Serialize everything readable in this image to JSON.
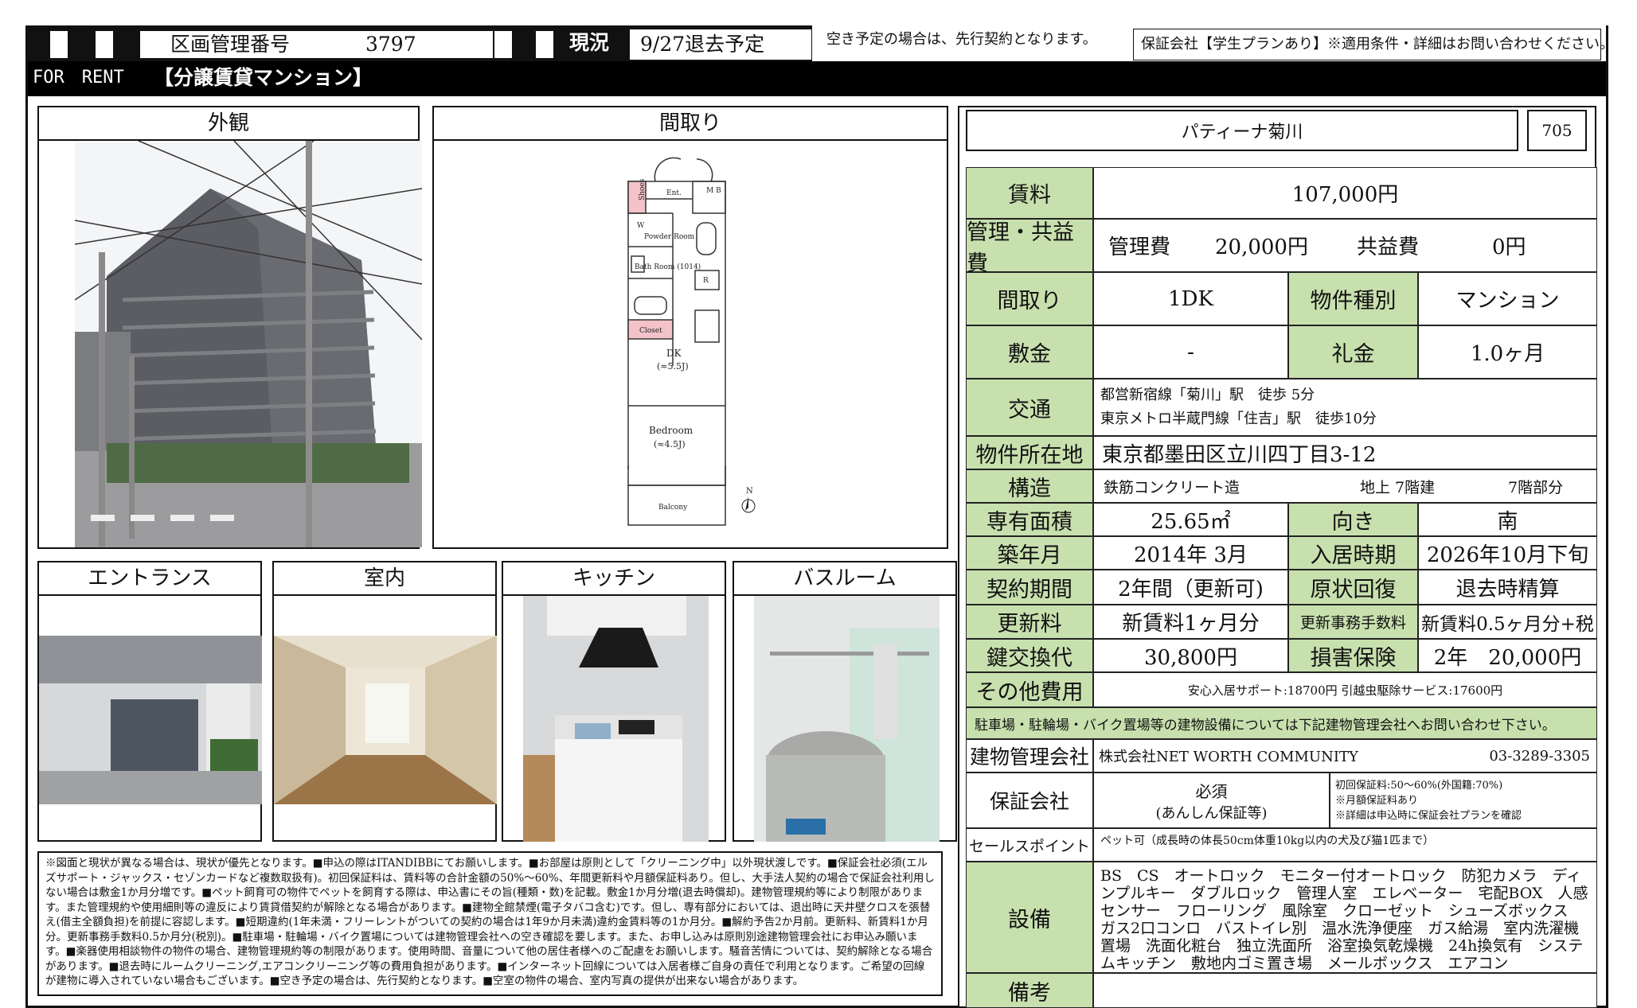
{
  "header": {
    "mgmt_label": "区画管理番号",
    "mgmt_number": "3797",
    "status_label": "現況",
    "status_value": "9/27退去予定",
    "vacancy_note": "空き予定の場合は、先行契約となります。",
    "guarantee_note": "保証会社【学生プランあり】※適用条件・詳細はお問い合わせください。",
    "for_rent": "FOR　RENT",
    "category": "【分譲賃貸マンション】"
  },
  "panels": {
    "exterior": "外観",
    "floorplan": "間取り",
    "entrance": "エントランス",
    "interior": "室内",
    "kitchen": "キッチン",
    "bathroom": "バスルーム"
  },
  "floorplan_labels": {
    "shoes": "Shoes",
    "ent": "Ent.",
    "mb": "M B",
    "w": "W",
    "powder": "Powder Room",
    "bath": "Bath Room (1014)",
    "r": "R",
    "closet": "Closet",
    "dk": "DK",
    "dk_size": "(≈5.5J)",
    "bedroom": "Bedroom",
    "bedroom_size": "(≈4.5J)",
    "balcony": "Balcony",
    "north": "N"
  },
  "property": {
    "name": "パティーナ菊川",
    "room": "705"
  },
  "specs": {
    "rent_label": "賃料",
    "rent": "107,000円",
    "fee_label": "管理・共益費",
    "mgmt_fee_label": "管理費",
    "mgmt_fee": "20,000円",
    "common_fee_label": "共益費",
    "common_fee": "0円",
    "layout_label": "間取り",
    "layout": "1DK",
    "type_label": "物件種別",
    "type": "マンション",
    "deposit_label": "敷金",
    "deposit": "-",
    "key_money_label": "礼金",
    "key_money": "1.0ヶ月",
    "access_label": "交通",
    "access_1": "都営新宿線「菊川」駅　徒歩 5分",
    "access_2": "東京メトロ半蔵門線「住吉」駅　徒歩10分",
    "address_label": "物件所在地",
    "address": "東京都墨田区立川四丁目3-12",
    "structure_label": "構造",
    "structure": "鉄筋コンクリート造",
    "floors": "地上 7階建",
    "floor": "7階部分",
    "area_label": "専有面積",
    "area": "25.65㎡",
    "direction_label": "向き",
    "direction": "南",
    "built_label": "築年月",
    "built": "2014年 3月",
    "movein_label": "入居時期",
    "movein": "2026年10月下旬",
    "term_label": "契約期間",
    "term": "2年間（更新可)",
    "restore_label": "原状回復",
    "restore": "退去時精算",
    "renewal_label": "更新料",
    "renewal": "新賃料1ヶ月分",
    "renewal_fee_label": "更新事務手数料",
    "renewal_fee": "新賃料0.5ヶ月分+税",
    "key_label": "鍵交換代",
    "key": "30,800円",
    "insurance_label": "損害保険",
    "insurance": "2年　20,000円",
    "other_label": "その他費用",
    "other": "安心入居サポート:18700円 引越虫駆除サービス:17600円",
    "parking_note": "駐車場・駐輪場・バイク置場等の建物設備については下記建物管理会社へお問い合わせ下さい。",
    "mgmt_co_label": "建物管理会社",
    "mgmt_co": "株式会社NET WORTH COMMUNITY",
    "mgmt_tel": "03-3289-3305",
    "guarantor_label": "保証会社",
    "guarantor_req": "必須",
    "guarantor_name": "(あんしん保証等)",
    "guarantor_note1": "初回保証料:50～60%(外国籍:70%)",
    "guarantor_note2": "※月額保証料あり",
    "guarantor_note3": "※詳細は申込時に保証会社プランを確認",
    "sales_label": "セールスポイント",
    "sales": "ペット可（成長時の体長50cm体重10kg以内の犬及び猫1匹まで）",
    "equipment_label": "設備",
    "equipment": "BS　CS　オートロック　モニター付オートロック　防犯カメラ　ディンプルキー　ダブルロック　管理人室　エレベーター　宅配BOX　人感センサー　フローリング　風除室　クローゼット　シューズボックス　ガス2口コンロ　バストイレ別　温水洗浄便座　ガス給湯　室内洗濯機置場　洗面化粧台　独立洗面所　浴室換気乾燥機　24h換気有　システムキッチン　敷地内ゴミ置き場　メールボックス　エアコン",
    "remarks_label": "備考"
  },
  "notes": "※図面と現状が異なる場合は、現状が優先となります。■申込の際はITANDIBBにてお願いします。■お部屋は原則として「クリーニング中」以外現状渡しです。■保証会社必須(エルズサポート・ジャックス・セゾンカードなど複数取扱有)。初回保証料は、賃料等の合計金額の50%～60%、年間更新料や月額保証料あり。但し、大手法人契約の場合で保証会社利用しない場合は敷金1か月分増です。■ペット飼育可の物件でペットを飼育する際は、申込書にその旨(種類・数)を記載。敷金1か月分増(退去時償却)。建物管理規約等により制限があります。また管理規約や使用細則等の違反により賃貸借契約が解除となる場合があります。■建物全館禁煙(電子タバコ含む)です。但し、専有部分においては、退出時に天井壁クロスを張替え(借主全額負担)を前提に容認します。■短期違約(1年未満・フリーレントがついての契約の場合は1年9か月未満)違約金賃料等の1か月分。■解約予告2か月前。更新料、新賃料1か月分。更新事務手数料0.5か月分(税別)。■駐車場・駐輪場・バイク置場については建物管理会社への空き確認を要します。また、お申し込みは原則別途建物管理会社にお申込み願います。■楽器使用相談物件の物件の場合、建物管理規約等の制限があります。使用時間、音量について他の居住者様へのご配慮をお願いします。騒音苦情については、契約解除となる場合があります。■退去時にルームクリーニング,エアコンクリーニング等の費用負担があります。■インターネット回線については入居者様ご自身の責任で利用となります。ご希望の回線が建物に導入されていない場合もございます。■空き予定の場合は、先行契約となります。■空室の物件の場合、室内写真の提供が出来ない場合があります。"
}
